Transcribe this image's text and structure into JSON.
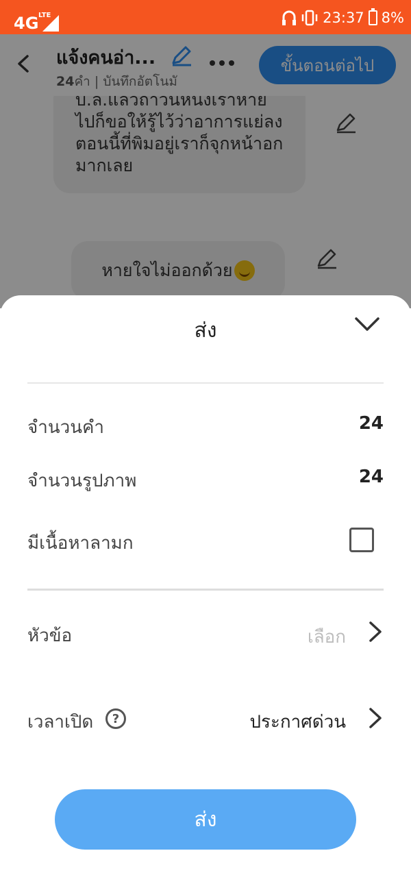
{
  "status_bar": {
    "network": "4G",
    "network_sub": "LTE",
    "time": "23:37",
    "battery": "8%"
  },
  "header": {
    "title": "แจ้งคนอ่า...",
    "word_count": "24",
    "subtitle": "คำ | บันทึกอัตโนมั",
    "next_label": "ขั้นตอนต่อไป"
  },
  "messages": [
    {
      "text": "บ.ล.แล้วถ้าวันหนึ่งเราหายไปก็ขอให้รู้ไว้ว่าอาการแย่ลงตอนนี้ที่พิมอยู่เราก็จุกหน้าอกมากเลย"
    },
    {
      "text": "หายใจไม่ออกด้วย"
    }
  ],
  "sheet": {
    "title": "ส่ง",
    "word_count_label": "จำนวนคำ",
    "word_count_value": "24",
    "image_count_label": "จำนวนรูปภาพ",
    "image_count_value": "24",
    "nsfw_label": "มีเนื้อหาลามก",
    "nsfw_checked": false,
    "topic_label": "หัวข้อ",
    "topic_placeholder": "เลือก",
    "publish_time_label": "เวลาเปิด",
    "publish_time_value": "ประกาศด่วน",
    "submit_label": "ส่ง"
  },
  "colors": {
    "status_bar": "#f5551f",
    "next_button": "#2f8ef1",
    "submit_button": "#5aaaf4"
  }
}
